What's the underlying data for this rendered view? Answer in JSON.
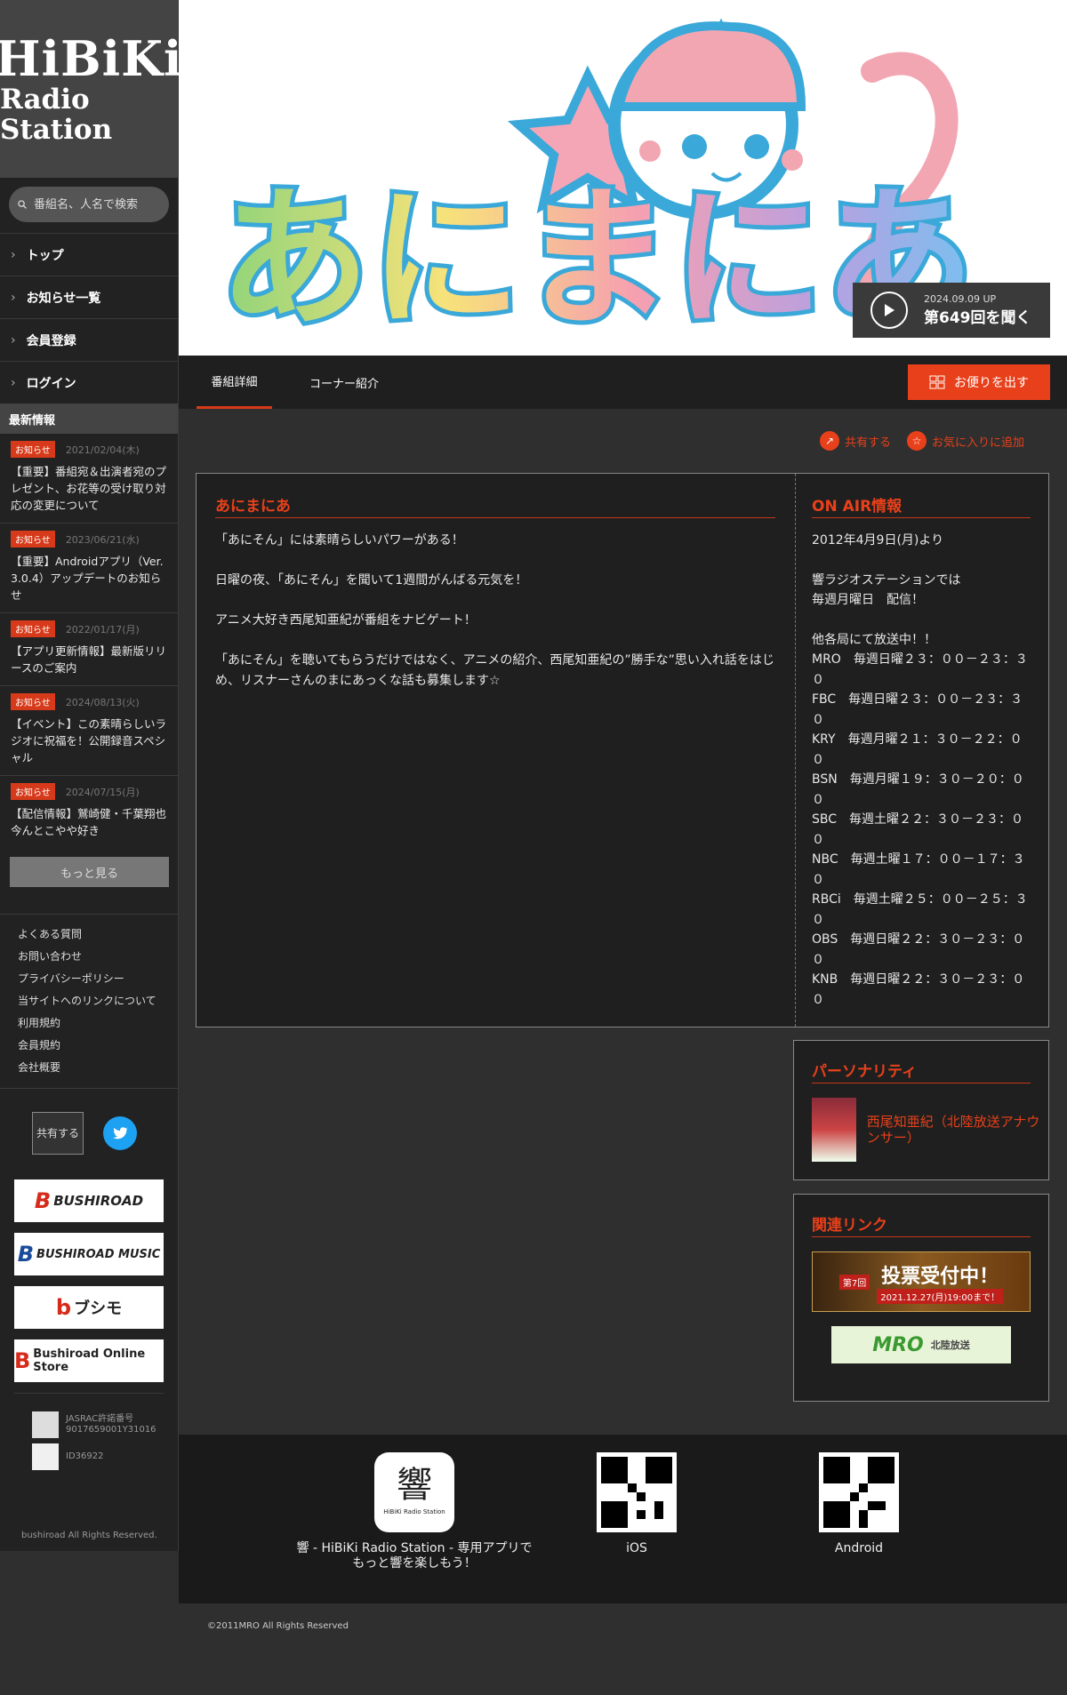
{
  "sidebar": {
    "logo_line1": "HiBiKi",
    "logo_line2": "Radio Station",
    "search_placeholder": "番組名、人名で検索",
    "nav": [
      "トップ",
      "お知らせ一覧",
      "会員登録",
      "ログイン"
    ],
    "news_heading": "最新情報",
    "news": [
      {
        "badge": "お知らせ",
        "date": "2021/02/04(木)",
        "text": "【重要】番組宛＆出演者宛のプレゼント、お花等の受け取り対応の変更について"
      },
      {
        "badge": "お知らせ",
        "date": "2023/06/21(水)",
        "text": "【重要】Androidアプリ（Ver. 3.0.4）アップデートのお知らせ"
      },
      {
        "badge": "お知らせ",
        "date": "2022/01/17(月)",
        "text": "【アプリ更新情報】最新版リリースのご案内"
      },
      {
        "badge": "お知らせ",
        "date": "2024/08/13(火)",
        "text": "【イベント】この素晴らしいラジオに祝福を！公開録音スペシャル"
      },
      {
        "badge": "お知らせ",
        "date": "2024/07/15(月)",
        "text": "【配信情報】鷲崎健・千葉翔也 今んとこやや好き"
      }
    ],
    "more_label": "もっと見る",
    "links": [
      "よくある質問",
      "お問い合わせ",
      "プライバシーポリシー",
      "当サイトへのリンクについて",
      "利用規約",
      "会員規約",
      "会社概要"
    ],
    "share_label": "共有する",
    "banners": [
      {
        "mark": "B",
        "text": "BUSHIROAD"
      },
      {
        "mark": "B",
        "text": "BUSHIROAD MUSIC"
      },
      {
        "mark": "b",
        "text": "ブシモ"
      },
      {
        "mark": "B",
        "text": "Bushiroad Online Store"
      }
    ],
    "jasrac": "JASRAC許諾番号\n9017659001Y31016",
    "id_code": "ID36922",
    "copyright": " bushiroad All Rights Reserved."
  },
  "hero": {
    "listen_date": "2024.09.09 UP",
    "listen_title": "第649回を聞く"
  },
  "tabs": [
    "番組詳細",
    "コーナー紹介"
  ],
  "letter_button": "お便りを出す",
  "actions": {
    "share": "共有する",
    "favorite": "お気に入りに追加"
  },
  "program": {
    "title": "あにまにあ",
    "paragraphs": [
      "「あにそん」には素晴らしいパワーがある！",
      "日曜の夜、「あにそん」を聞いて1週間がんばる元気を！",
      "アニメ大好き西尾知亜紀が番組をナビゲート！",
      "「あにそん」を聴いてもらうだけではなく、アニメの紹介、西尾知亜紀の”勝手な”思い入れ話をはじめ、リスナーさんのまにあっくな話も募集します☆"
    ]
  },
  "onair": {
    "title": "ON AIR情報",
    "start": "2012年4月9日(月)より",
    "station_line1": "響ラジオステーションでは",
    "station_line2": "毎週月曜日　配信！",
    "others_label": "他各局にて放送中！！",
    "schedule": [
      "MRO　毎週日曜２３：００－２３：３０",
      "FBC　毎週日曜２３：００－２３：３０",
      "KRY　毎週月曜２１：３０－２２：００",
      "BSN　毎週月曜１９：３０－２０：００",
      "SBC　毎週土曜２２：３０－２３：００",
      "NBC　毎週土曜１７：００－１７：３０",
      "RBCi　毎週土曜２５：００－２５：３０",
      "OBS　毎週日曜２２：３０－２３：００",
      "KNB　毎週日曜２２：３０－２３：００"
    ]
  },
  "personality": {
    "title": "パーソナリティ",
    "name": "西尾知亜紀（北陸放送アナウンサー）"
  },
  "related": {
    "title": "関連リンク",
    "award_main": "投票受付中！",
    "award_sub": "2021.12.27(月)19:00まで！",
    "award_badge": "第7回",
    "mro_logo": "MRO",
    "mro_text": "北陸放送"
  },
  "footer": {
    "app_glyph": "響",
    "app_small": "HiBiKi Radio Station",
    "app_text_line1": "響 - HiBiKi Radio Station - 専用アプリで",
    "app_text_line2": "もっと響を楽しもう！",
    "ios": " iOS",
    "android": " Android",
    "copyright": "©2011MRO All Rights Reserved"
  },
  "colors": {
    "accent": "#e8401a",
    "badge": "#d63a1a",
    "twitter": "#1da1f2"
  }
}
